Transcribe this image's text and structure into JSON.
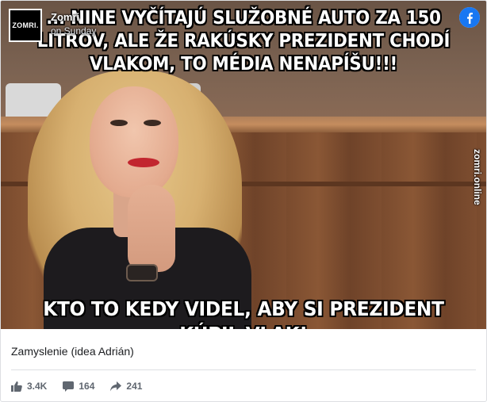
{
  "post": {
    "page_name": "Zomri",
    "post_time": "on Sunday",
    "avatar_text": "ZOMRI.",
    "caption": "Zamyslenie (idea Adrián)"
  },
  "image": {
    "top_text": "... NINE VYČÍTAJÚ SLUŽOBNÉ AUTO ZA 150 LITROV, ALE ŽE RAKÚSKY PREZIDENT CHODÍ VLAKOM, TO MÉDIA NENAPÍŠU!!!",
    "bottom_text": "KTO TO KEDY VIDEL, ABY SI PREZIDENT KÚPIL VLAK!",
    "watermark": "zomri.online"
  },
  "stats": {
    "likes": "3.4K",
    "comments": "164",
    "shares": "241"
  },
  "icons": {
    "facebook": "facebook-logo-icon",
    "like": "thumbs-up-icon",
    "comment": "comment-icon",
    "share": "share-arrow-icon"
  },
  "colors": {
    "facebook_blue": "#1877f2",
    "stat_gray": "#606770",
    "divider": "#dddfe2"
  }
}
